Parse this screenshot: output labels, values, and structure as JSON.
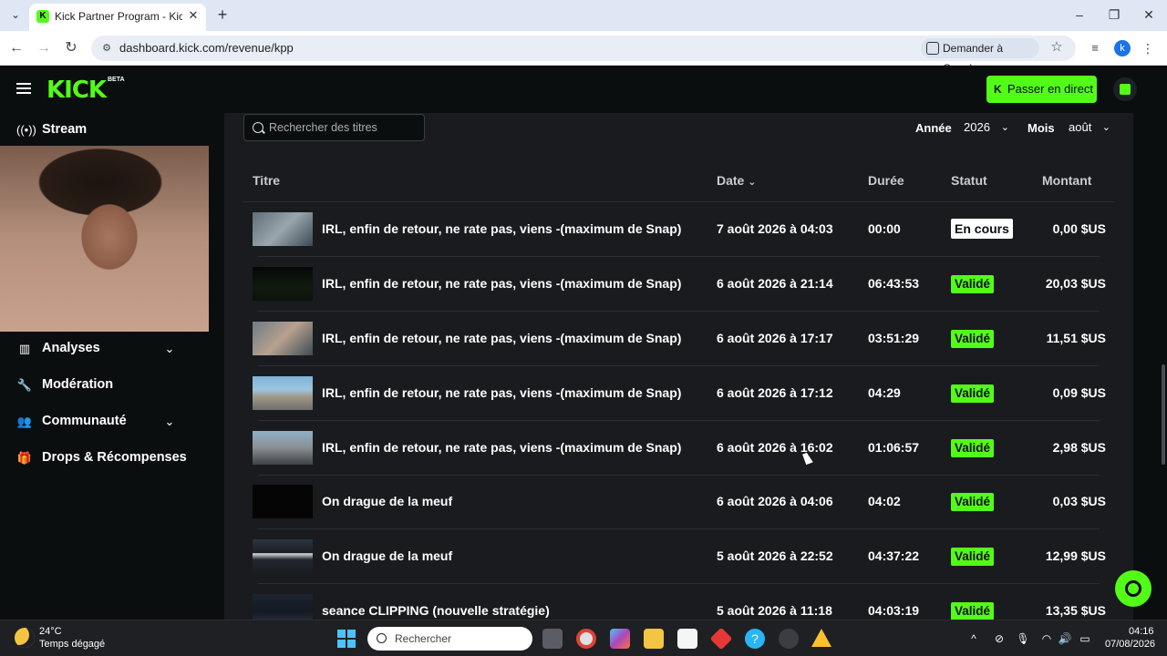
{
  "browser": {
    "tab_title": "Kick Partner Program - Kick Das",
    "url": "dashboard.kick.com/revenue/kpp",
    "ask_google": "Demander à Google",
    "profile_initial": "k"
  },
  "header": {
    "logo": "KICK",
    "beta": "BETA",
    "go_live": "Passer en direct"
  },
  "sidebar": {
    "items": [
      {
        "label": "Stream",
        "icon": "broadcast-icon"
      },
      {
        "label": "Analyses",
        "icon": "chart-icon"
      },
      {
        "label": "Modération",
        "icon": "wrench-icon"
      },
      {
        "label": "Communauté",
        "icon": "users-icon"
      },
      {
        "label": "Drops & Récompenses",
        "icon": "gift-icon"
      }
    ]
  },
  "filters": {
    "search_placeholder": "Rechercher des titres",
    "year_label": "Année",
    "year_value": "2026",
    "month_label": "Mois",
    "month_value": "août"
  },
  "table": {
    "headers": [
      "Titre",
      "Date",
      "Durée",
      "Statut",
      "Montant"
    ],
    "rows": [
      {
        "title": "IRL, enfin de retour, ne rate pas, viens -(maximum de Snap)",
        "date": "7 août 2026 à 04:03",
        "duration": "00:00",
        "status": "En cours",
        "amount": "0,00 $US"
      },
      {
        "title": "IRL, enfin de retour, ne rate pas, viens -(maximum de Snap)",
        "date": "6 août 2026 à 21:14",
        "duration": "06:43:53",
        "status": "Validé",
        "amount": "20,03 $US"
      },
      {
        "title": "IRL, enfin de retour, ne rate pas, viens -(maximum de Snap)",
        "date": "6 août 2026 à 17:17",
        "duration": "03:51:29",
        "status": "Validé",
        "amount": "11,51 $US"
      },
      {
        "title": "IRL, enfin de retour, ne rate pas, viens -(maximum de Snap)",
        "date": "6 août 2026 à 17:12",
        "duration": "04:29",
        "status": "Validé",
        "amount": "0,09 $US"
      },
      {
        "title": "IRL, enfin de retour, ne rate pas, viens -(maximum de Snap)",
        "date": "6 août 2026 à 16:02",
        "duration": "01:06:57",
        "status": "Validé",
        "amount": "2,98 $US"
      },
      {
        "title": "On drague de la meuf",
        "date": "6 août 2026 à 04:06",
        "duration": "04:02",
        "status": "Validé",
        "amount": "0,03 $US"
      },
      {
        "title": "On drague de la meuf",
        "date": "5 août 2026 à 22:52",
        "duration": "04:37:22",
        "status": "Validé",
        "amount": "12,99 $US"
      },
      {
        "title": "seance CLIPPING (nouvelle stratégie)",
        "date": "5 août 2026 à 11:18",
        "duration": "04:03:19",
        "status": "Validé",
        "amount": "13,35 $US"
      }
    ]
  },
  "taskbar": {
    "temperature": "24°C",
    "weather": "Temps dégagé",
    "search": "Rechercher",
    "time": "04:16",
    "date": "07/08/2026"
  },
  "colors": {
    "brand": "#53fc18",
    "panel": "#191b1f",
    "background": "#0b0e0f"
  }
}
